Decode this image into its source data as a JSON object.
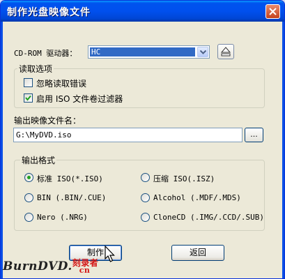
{
  "window": {
    "title": "制作光盘映像文件"
  },
  "drive": {
    "label": "CD-ROM 驱动器：",
    "selected": "HC"
  },
  "read_options": {
    "title": "读取选项",
    "ignore_errors": {
      "label": "忽略读取错误",
      "checked": false
    },
    "iso_filter": {
      "label": "启用 ISO 文件卷过滤器",
      "checked": true
    }
  },
  "output_file": {
    "label": "输出映像文件名：",
    "value": "G:\\MyDVD.iso",
    "browse_label": "..."
  },
  "output_format": {
    "title": "输出格式",
    "options": [
      {
        "label": "标准 ISO(*.ISO)",
        "selected": true
      },
      {
        "label": "压缩 ISO(.ISZ)",
        "selected": false
      },
      {
        "label": "BIN (.BIN/.CUE)",
        "selected": false
      },
      {
        "label": "Alcohol (.MDF/.MDS)",
        "selected": false
      },
      {
        "label": "Nero (.NRG)",
        "selected": false
      },
      {
        "label": "CloneCD (.IMG/.CCD/.SUB)",
        "selected": false
      }
    ]
  },
  "buttons": {
    "make": "制作",
    "back": "返回"
  },
  "watermark": {
    "text": "BurnDVD.",
    "cn_top": "刻录者",
    "cn_bottom": "cn"
  }
}
